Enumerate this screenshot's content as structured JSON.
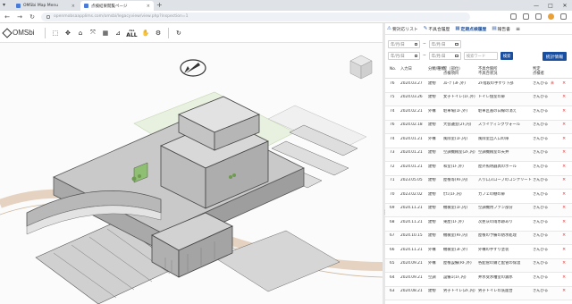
{
  "browser": {
    "tabs": [
      {
        "label": "OMSbi Map Menu",
        "active": false
      },
      {
        "label": "点検結果閲覧ページ",
        "active": true
      }
    ],
    "new_tab": "+",
    "url": "openmobsaapplims.com/omsbi/legacyview/view.php?inspection=1",
    "window_controls": [
      "—",
      "□",
      "✕"
    ]
  },
  "app": {
    "logo": "OMSbi",
    "toolbar": {
      "all_label": "ALL",
      "all_sub": "ALL"
    }
  },
  "panel": {
    "tabs": [
      {
        "icon": "warning-icon",
        "label": "要対応リスト",
        "active": false
      },
      {
        "icon": "pencil-icon",
        "label": "不具合履歴",
        "active": false
      },
      {
        "icon": "grid-icon",
        "label": "定期点検履歴",
        "active": true
      },
      {
        "icon": "report-icon",
        "label": "報告書",
        "active": false
      }
    ],
    "filters": {
      "date_from_placeholder": "年/月/日",
      "date_to_placeholder": "年/月/日",
      "date_from2_placeholder": "年/月/日",
      "date_to2_placeholder": "年/月/日",
      "range_sep": "~",
      "keyword_placeholder": "検索ワード",
      "search_label": "検索",
      "stats_label": "統計情報"
    },
    "columns": {
      "no": "No.",
      "date": "入力日",
      "type": "分類/種類",
      "loc": "室（部位）",
      "loc2": "点検項目",
      "desc": "不具合箇所",
      "desc2": "不具合状況",
      "ver": "判定",
      "ver2": "点検者"
    },
    "rows": [
      {
        "no": "76",
        "date": "2024.03.27",
        "type": "建物",
        "loc": "ｽﾛｰﾌﾟ(3F,外)",
        "desc": "2F階段の手すり下部",
        "ver": "きんびる",
        "tag": "未"
      },
      {
        "no": "75",
        "date": "2024.03.26",
        "type": "建物",
        "loc": "女子トイレ(1F,外)",
        "desc": "トイレ個室の扉",
        "ver": "きんびる",
        "tag": ""
      },
      {
        "no": "74",
        "date": "2024.02.21",
        "type": "外構",
        "loc": "駐車場(1F,外)",
        "desc": "駐車区画の白線の消え",
        "ver": "きんびる",
        "tag": ""
      },
      {
        "no": "76",
        "date": "2024.02.18",
        "type": "建物",
        "loc": "大会議室(2F,内)",
        "desc": "スライディングウォール",
        "ver": "きんびる",
        "tag": ""
      },
      {
        "no": "74",
        "date": "2024.01.21",
        "type": "外構",
        "loc": "風除室(1F,内)",
        "desc": "風除室出入口の扉",
        "ver": "きんびる",
        "tag": ""
      },
      {
        "no": "73",
        "date": "2024.01.21",
        "type": "建物",
        "loc": "空調機械室(2F,内)",
        "desc": "空調機械室の天井",
        "ver": "きんびる",
        "tag": ""
      },
      {
        "no": "72",
        "date": "2024.01.21",
        "type": "建物",
        "loc": "和室(1F,外)",
        "desc": "屋外照明器具のポール",
        "ver": "きんびる",
        "tag": ""
      },
      {
        "no": "71",
        "date": "2023.05.05",
        "type": "建物",
        "loc": "屋根等(RF,内)",
        "desc": "入り口スロープのコンクリート",
        "ver": "きんびる",
        "tag": ""
      },
      {
        "no": "70",
        "date": "2023.02.02",
        "type": "建物",
        "loc": "ｶﾌｪ(1F,内)",
        "desc": "カフェの棚の扉",
        "ver": "きんびる",
        "tag": ""
      },
      {
        "no": "69",
        "date": "2024.11.21",
        "type": "建物",
        "loc": "機械室(1F,内)",
        "desc": "空調機用ファン部分",
        "ver": "きんびる",
        "tag": ""
      },
      {
        "no": "68",
        "date": "2024.11.21",
        "type": "建物",
        "loc": "東屋(1F,外)",
        "desc": "次亜灰の雨水跡あり",
        "ver": "きんびる",
        "tag": ""
      },
      {
        "no": "67",
        "date": "2024.10.15",
        "type": "建物",
        "loc": "機械室(RF,内)",
        "desc": "屋根の予備の防水処理",
        "ver": "きんびる",
        "tag": ""
      },
      {
        "no": "66",
        "date": "2024.11.21",
        "type": "外構",
        "loc": "機械室(3F,外)",
        "desc": "外構の手すり塗装",
        "ver": "きんびる",
        "tag": ""
      },
      {
        "no": "65",
        "date": "2024.09.21",
        "type": "外構",
        "loc": "屋根設備(RF,外)",
        "desc": "各配管の錆と配管の保温",
        "ver": "きんびる",
        "tag": ""
      },
      {
        "no": "64",
        "date": "2024.09.21",
        "type": "空調",
        "loc": "設備1(1F,内)",
        "desc": "井水受水槽室の漏水",
        "ver": "きんびる",
        "tag": ""
      },
      {
        "no": "63",
        "date": "2024.08.21",
        "type": "建物",
        "loc": "男子トイレ(2F,内)",
        "desc": "男子トイレの洗面台",
        "ver": "きんびる",
        "tag": ""
      }
    ]
  }
}
